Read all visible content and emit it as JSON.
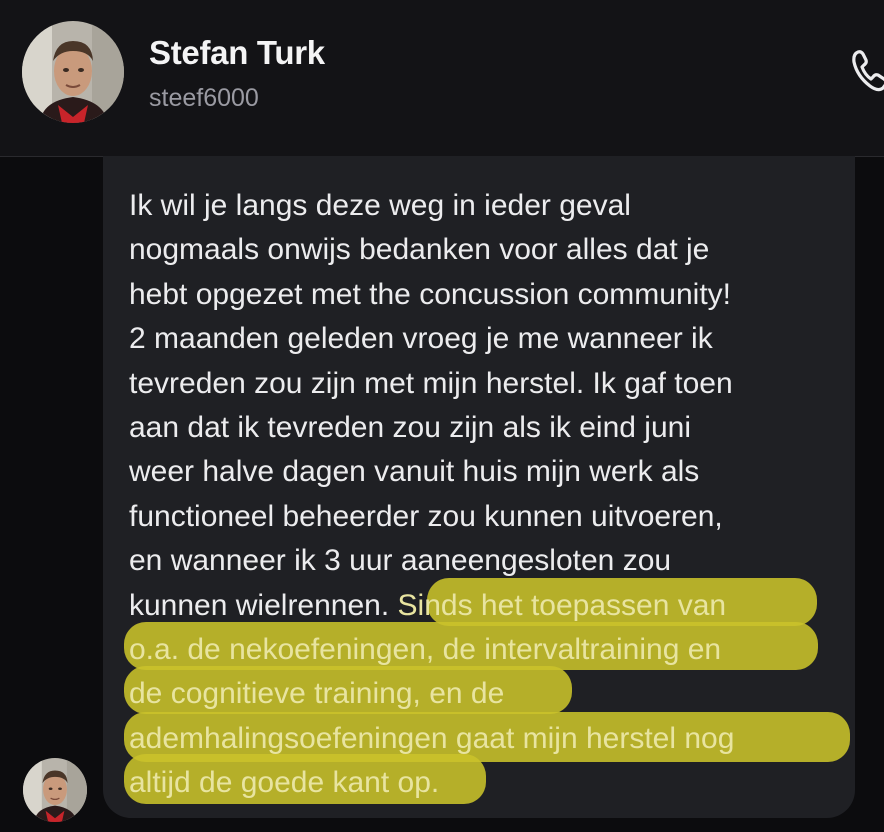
{
  "contact": {
    "name": "Stefan Turk",
    "handle": "steef6000"
  },
  "message": {
    "lines": [
      "Ik wil je langs deze weg in ieder geval",
      "nogmaals onwijs bedanken voor alles dat je",
      "hebt opgezet met the concussion community!",
      "2 maanden geleden vroeg je me wanneer ik",
      "tevreden zou zijn met mijn herstel. Ik gaf toen",
      "aan dat ik tevreden zou zijn als ik eind juni",
      "weer halve dagen vanuit huis mijn werk als",
      "functioneel beheerder zou kunnen uitvoeren,",
      "en wanneer ik 3 uur aaneengesloten zou"
    ],
    "line10_plain": "kunnen wielrennen. ",
    "line10_highlight": "Sinds het toepassen van",
    "highlight_lines": [
      "o.a. de nekoefeningen, de intervaltraining en",
      "de cognitieve training, en de",
      "ademhalingsoefeningen gaat mijn herstel nog",
      "altijd de goede kant op."
    ]
  },
  "colors": {
    "background": "#0c0c0e",
    "bubble": "#1f2024",
    "highlight": "#cbc32a"
  },
  "icons": {
    "call": "phone-icon"
  }
}
